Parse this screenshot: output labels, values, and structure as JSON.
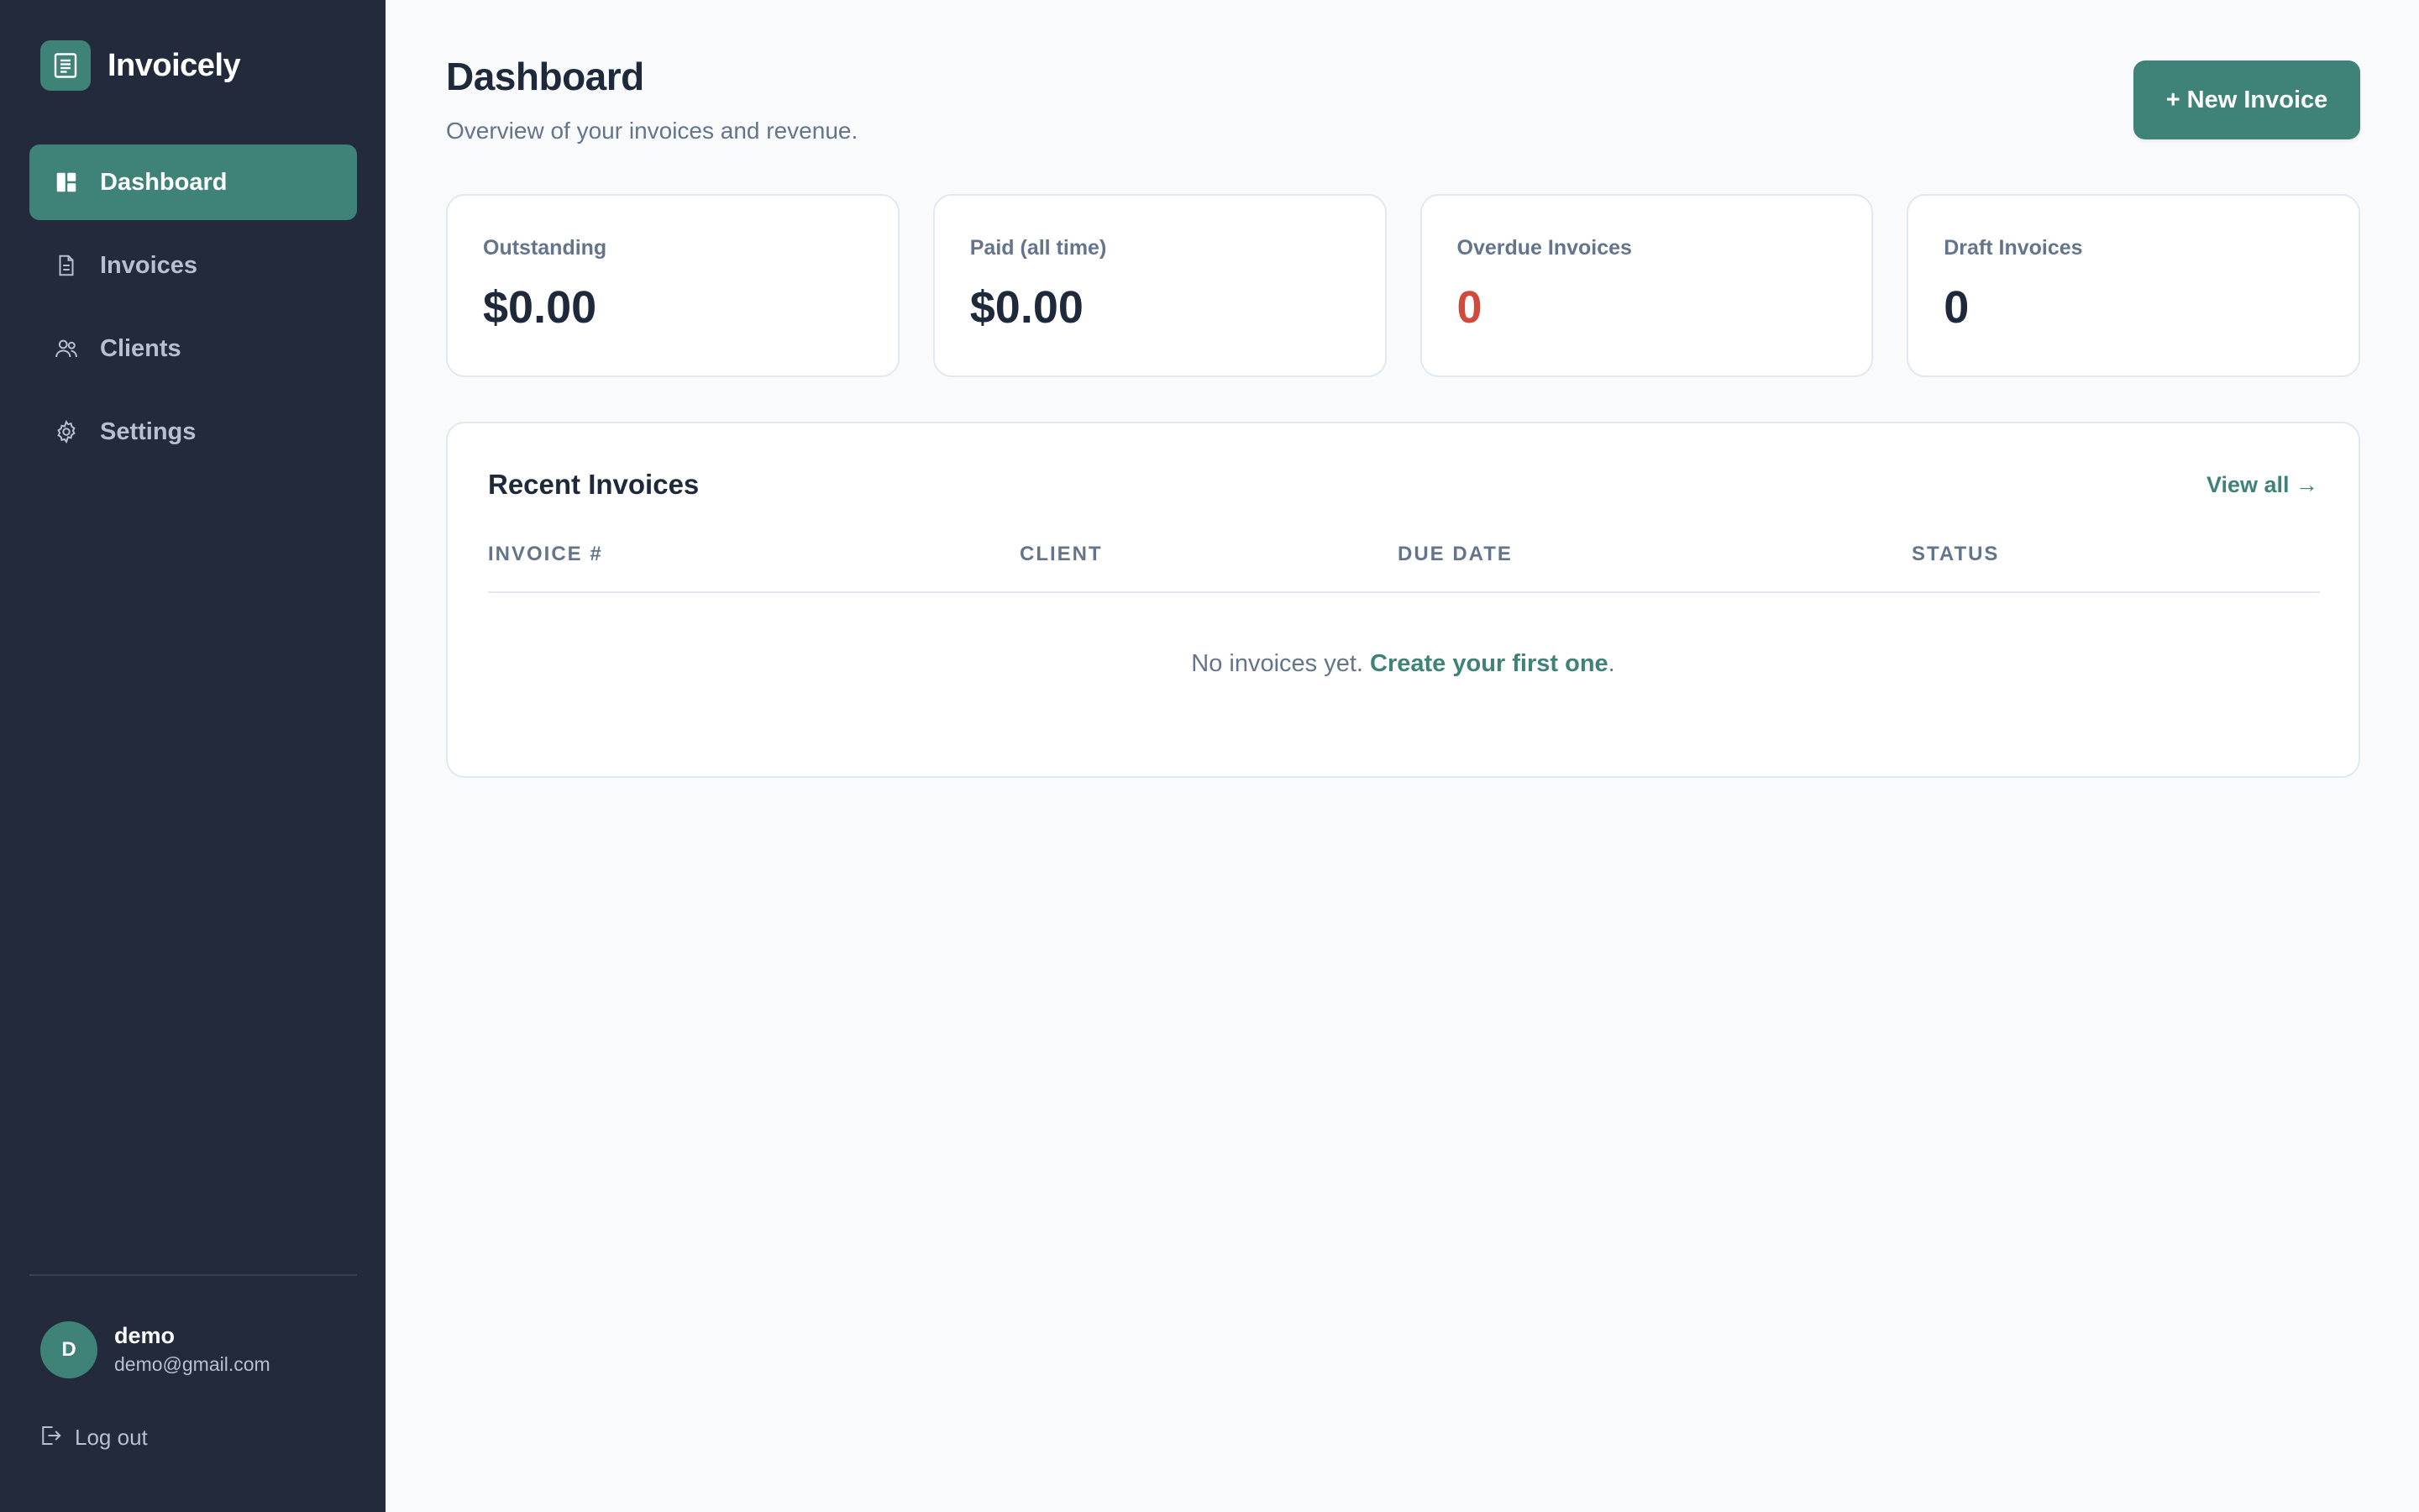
{
  "app": {
    "name": "Invoicely",
    "accent_color": "#3f8378",
    "sidebar_color": "#222a3b"
  },
  "sidebar": {
    "items": [
      {
        "label": "Dashboard",
        "icon": "dashboard-icon",
        "active": true
      },
      {
        "label": "Invoices",
        "icon": "document-icon",
        "active": false
      },
      {
        "label": "Clients",
        "icon": "users-icon",
        "active": false
      },
      {
        "label": "Settings",
        "icon": "gear-icon",
        "active": false
      }
    ],
    "user": {
      "initial": "D",
      "name": "demo",
      "email": "demo@gmail.com"
    },
    "logout_label": "Log out"
  },
  "header": {
    "title": "Dashboard",
    "subtitle": "Overview of your invoices and revenue.",
    "new_invoice_label": "+ New Invoice"
  },
  "stats": [
    {
      "label": "Outstanding",
      "value": "$0.00"
    },
    {
      "label": "Paid (all time)",
      "value": "$0.00"
    },
    {
      "label": "Overdue Invoices",
      "value": "0",
      "color": "#d14b3c"
    },
    {
      "label": "Draft Invoices",
      "value": "0"
    }
  ],
  "recent_invoices": {
    "title": "Recent Invoices",
    "view_all_label": "View all →",
    "columns": [
      "INVOICE #",
      "CLIENT",
      "DUE DATE",
      "STATUS"
    ],
    "rows": [],
    "empty_text": "No invoices yet.",
    "empty_link": "Create your first one",
    "empty_suffix": "."
  }
}
